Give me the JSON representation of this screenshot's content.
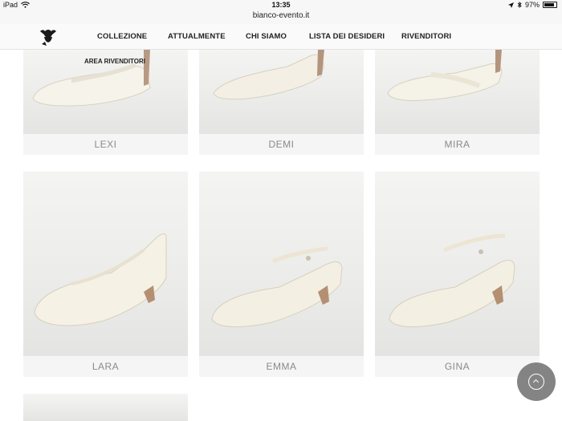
{
  "statusbar": {
    "device": "iPad",
    "time": "13:35",
    "battery": "97%",
    "url": "bianco-evento.it"
  },
  "nav": {
    "items": [
      "COLLEZIONE",
      "ATTUALMENTE",
      "CHI SIAMO",
      "LISTA DEI DESIDERI",
      "RIVENDITORI"
    ],
    "submenu": "AREA RIVENDITORI"
  },
  "products": [
    {
      "name": "LEXI"
    },
    {
      "name": "DEMI"
    },
    {
      "name": "MIRA"
    },
    {
      "name": "LARA"
    },
    {
      "name": "EMMA"
    },
    {
      "name": "GINA"
    }
  ],
  "colors": {
    "background": "#ffffff",
    "label_text": "#8a8a8a",
    "scroll_button": "#6e6e6e"
  }
}
